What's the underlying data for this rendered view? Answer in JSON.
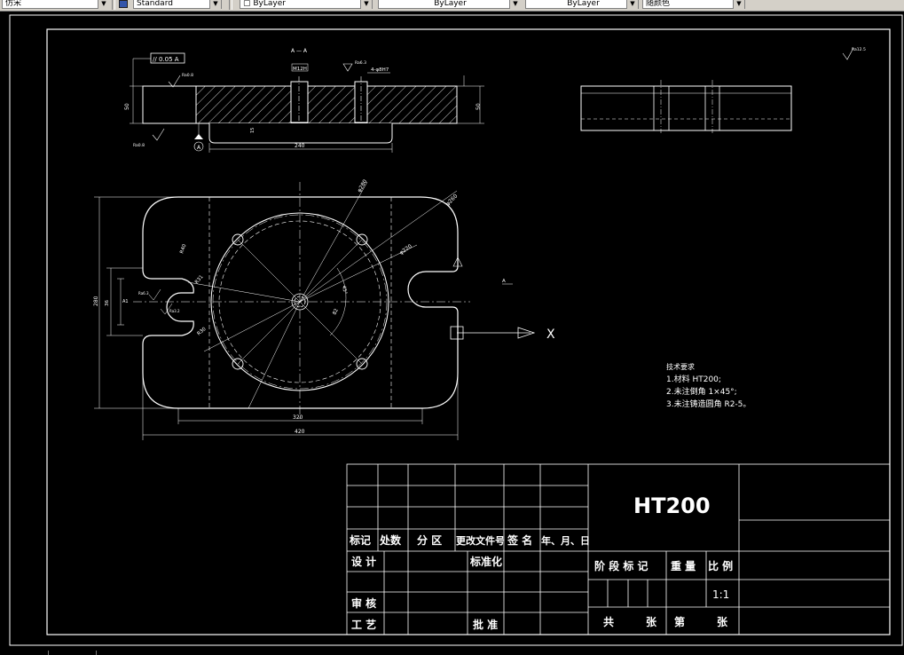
{
  "toolbar": {
    "text_style": "Standard",
    "combo1": "仿宋",
    "layer_color": "ByLayer",
    "layer_linetype": "ByLayer",
    "layer_lineweight": "ByLayer",
    "plot_style": "随颜色"
  },
  "drawing": {
    "section_label": "A — A",
    "roughness_topright": "Ra12.5",
    "roughness_1": "Ra0.8",
    "roughness_2": "Ra0.8",
    "roughness_3": "Ra6.3",
    "roughness_4": "Ra6.3",
    "roughness_5": "Ra3.2",
    "tolerance_frame": "// 0.05 A",
    "datum_label": "A",
    "dim_width_right": "50",
    "dim_width_left": "50",
    "dim_hole": "M12H",
    "dim_hole2": "4-φ8H7",
    "dim_length": "240",
    "dim_slot_depth": "15",
    "dim_diameter_outer": "φ280",
    "dim_radius_corner": "R40",
    "dim_diameter_ring": "φ220",
    "dim_diameter_bolt": "φ260",
    "dim_angle": "45°",
    "dim_height": "280",
    "dim_slot_w": "36",
    "dim_slot_inner": "A1",
    "dim_r1": "R31",
    "dim_r2": "R30",
    "dim_center": "82",
    "dim_bottom_inner": "320",
    "dim_bottom_outer": "420",
    "view_label": "A",
    "axis_x": "X",
    "notes_title": "技术要求",
    "notes": [
      "1.材料 HT200;",
      "2.未注倒角 1×45°;",
      "3.未注铸造圆角 R2-5。"
    ]
  },
  "title_block": {
    "material": "HT200",
    "hdr_mark": "标记",
    "hdr_count": "处数",
    "hdr_zone": "分 区",
    "hdr_doc": "更改文件号",
    "hdr_sign": "签 名",
    "hdr_date": "年、月、日",
    "design": "设 计",
    "standardize": "标准化",
    "review": "审 核",
    "process": "工 艺",
    "approve": "批 准",
    "stage_mark": "阶 段 标 记",
    "weight": "重 量",
    "scale_label": "比 例",
    "scale_value": "1:1",
    "total": "共",
    "sheets1": "张",
    "page_no": "第",
    "sheets2": "张"
  }
}
